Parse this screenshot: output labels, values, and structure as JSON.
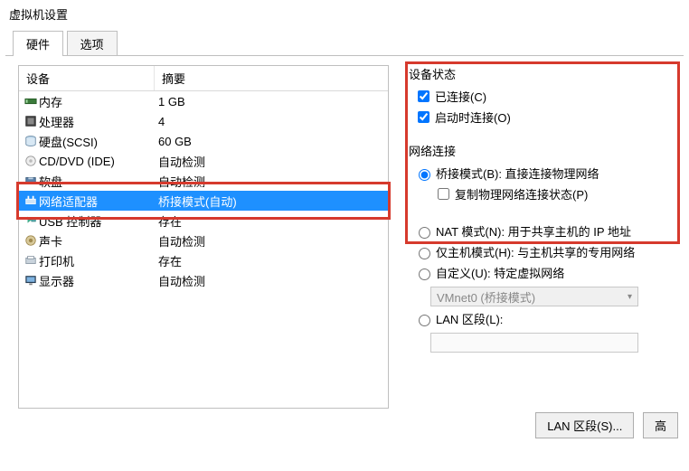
{
  "window": {
    "title": "虚拟机设置"
  },
  "tabs": {
    "hardware": "硬件",
    "options": "选项",
    "active": "hardware"
  },
  "table": {
    "header_device": "设备",
    "header_summary": "摘要"
  },
  "devices": [
    {
      "name": "内存",
      "summary": "1 GB"
    },
    {
      "name": "处理器",
      "summary": "4"
    },
    {
      "name": "硬盘(SCSI)",
      "summary": "60 GB"
    },
    {
      "name": "CD/DVD (IDE)",
      "summary": "自动检测"
    },
    {
      "name": "软盘",
      "summary": "自动检测"
    },
    {
      "name": "网络适配器",
      "summary": "桥接模式(自动)"
    },
    {
      "name": "USB 控制器",
      "summary": "存在"
    },
    {
      "name": "声卡",
      "summary": "自动检测"
    },
    {
      "name": "打印机",
      "summary": "存在"
    },
    {
      "name": "显示器",
      "summary": "自动检测"
    }
  ],
  "selected_index": 5,
  "device_status": {
    "group_label": "设备状态",
    "connected": {
      "label": "已连接(C)",
      "checked": true
    },
    "connect_at_poweron": {
      "label": "启动时连接(O)",
      "checked": true
    }
  },
  "network": {
    "group_label": "网络连接",
    "bridged": {
      "label": "桥接模式(B): 直接连接物理网络",
      "selected": true
    },
    "replicate": {
      "label": "复制物理网络连接状态(P)",
      "checked": false
    },
    "nat": {
      "label": "NAT 模式(N): 用于共享主机的 IP 地址",
      "selected": false
    },
    "hostonly": {
      "label": "仅主机模式(H): 与主机共享的专用网络",
      "selected": false
    },
    "custom": {
      "label": "自定义(U): 特定虚拟网络",
      "selected": false
    },
    "custom_value": "VMnet0 (桥接模式)",
    "lan_segment": {
      "label": "LAN 区段(L):",
      "selected": false
    }
  },
  "buttons": {
    "lan_segments": "LAN 区段(S)...",
    "advanced": "高"
  }
}
